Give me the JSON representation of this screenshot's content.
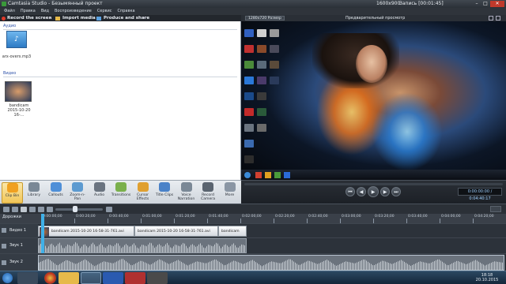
{
  "window": {
    "title": "Camtasia Studio - Безымянный проект",
    "resolution": "1600x900",
    "recording": "Запись [00:01:45]"
  },
  "menu": [
    "Файл",
    "Правка",
    "Вид",
    "Воспроизведение",
    "Сервис",
    "Справка"
  ],
  "toolbar": {
    "record": "Record the screen",
    "import": "Import media",
    "produce": "Produce and share"
  },
  "clip_bin": {
    "audio_section": "Аудио",
    "audio_clip": "arx-overs.mp3",
    "video_section": "Видео",
    "video_clip": "bandicam 2015-10-20 16-..."
  },
  "preview": {
    "size_select": "1280x720 Размер",
    "label": "Предварительный просмотр",
    "time": "0:00:00:00 / 0:04:40:17"
  },
  "ribbon": [
    {
      "name": "Clip Bin",
      "label": "Clip Bin",
      "color": "#f0a020"
    },
    {
      "name": "Library",
      "label": "Library",
      "color": "#7a8896"
    },
    {
      "name": "Callouts",
      "label": "Callouts",
      "color": "#4e8fd8"
    },
    {
      "name": "Zoom-n-Pan",
      "label": "Zoom-n-Pan",
      "color": "#5c9ad0"
    },
    {
      "name": "Audio",
      "label": "Audio",
      "color": "#6a7480"
    },
    {
      "name": "Transitions",
      "label": "Transitions",
      "color": "#7ab04c"
    },
    {
      "name": "Cursor Effects",
      "label": "Cursor Effects",
      "color": "#e0a030"
    },
    {
      "name": "Title Clips",
      "label": "Title Clips",
      "color": "#4a82c8"
    },
    {
      "name": "Voice Narration",
      "label": "Voice Narration",
      "color": "#7a8896"
    },
    {
      "name": "Record Camera",
      "label": "Record Camera",
      "color": "#5a6470"
    },
    {
      "name": "More",
      "label": "More",
      "color": "#8a96a4"
    }
  ],
  "timeline": {
    "tracks_label": "Дорожки",
    "ticks": [
      "0:00:00;00",
      "0:00:20;00",
      "0:00:40;00",
      "0:01:00;00",
      "0:01:20;00",
      "0:01:40;00",
      "0:02:00;00",
      "0:02:20;00",
      "0:02:40;00",
      "0:03:00;00",
      "0:03:20;00",
      "0:03:40;00",
      "0:04:00;00",
      "0:04:20;00"
    ],
    "video_track": "Видео 1",
    "audio_track1": "Звук 1",
    "audio_track2": "Звук 2",
    "clip1": "bandicam 2015-10-20 16-58-31-761.avi",
    "clip2": "bandicam 2015-10-20 16-58-31-761.avi",
    "clip3": "bandicam"
  },
  "taskbar": {
    "time": "18:18",
    "date": "20.10.2015"
  }
}
